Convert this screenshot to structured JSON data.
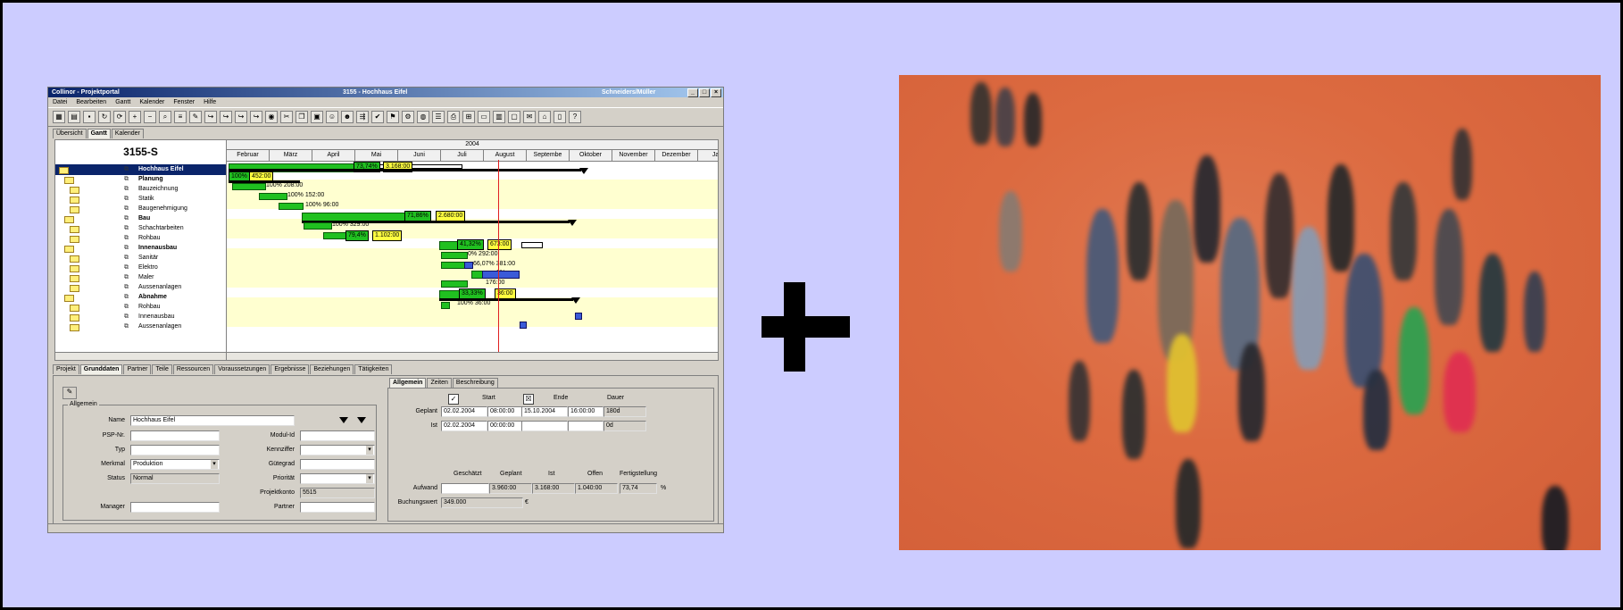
{
  "window": {
    "app_title": "Collinor - Projektportal",
    "doc_title": "3155 - Hochhaus Eifel",
    "user": "Schneiders/Müller"
  },
  "menu": [
    "Datei",
    "Bearbeiten",
    "Gantt",
    "Kalender",
    "Fenster",
    "Hilfe"
  ],
  "view_tabs": [
    "Übersicht",
    "Gantt",
    "Kalender"
  ],
  "project_code": "3155-S",
  "gantt": {
    "year": "2004",
    "months": [
      "Februar",
      "März",
      "April",
      "Mai",
      "Juni",
      "Juli",
      "August",
      "Septembe",
      "Oktober",
      "November",
      "Dezember",
      "Janu"
    ],
    "rows": [
      {
        "name": "Hochhaus Eifel",
        "selected": true,
        "bold": true
      },
      {
        "name": "Planung",
        "bold": true
      },
      {
        "name": "Bauzeichnung"
      },
      {
        "name": "Statik"
      },
      {
        "name": "Baugenehmigung"
      },
      {
        "name": "Bau",
        "bold": true
      },
      {
        "name": "Schachtarbeiten"
      },
      {
        "name": "Rohbau"
      },
      {
        "name": "Innenausbau",
        "bold": true
      },
      {
        "name": "Sanitär"
      },
      {
        "name": "Elektro"
      },
      {
        "name": "Maler"
      },
      {
        "name": "Aussenanlagen"
      },
      {
        "name": "Abnahme",
        "bold": true
      },
      {
        "name": "Rohbau"
      },
      {
        "name": "Innenausbau"
      },
      {
        "name": "Aussenanlagen"
      }
    ],
    "labels": {
      "r0_pct": "73,74%",
      "r0_val": "3.168:00",
      "r1_pct": "100%",
      "r1_val": "452:00",
      "r2": "100%  208:00",
      "r3": "100%  152:00",
      "r4": "100%  96:00",
      "r5_pct": "71,86%",
      "r5_val": "2.680:00",
      "r6": "100%  329:00",
      "r7_pct": "79,4%",
      "r7_val": "1.102:00",
      "r8_pct": "41,32%",
      "r8_val": "673:00",
      "r9": "0%  292:00",
      "r10": "66,07%  381:00",
      "r11": "0%",
      "r12": "176:00",
      "r13_pct": "33,33%",
      "r13_val": "36:00",
      "r14": "100%  36:00"
    }
  },
  "detail_tabs": [
    "Projekt",
    "Grunddaten",
    "Partner",
    "Teile",
    "Ressourcen",
    "Voraussetzungen",
    "Ergebnisse",
    "Beziehungen",
    "Tätigkeiten"
  ],
  "left_form": {
    "group": "Allgemein",
    "name_label": "Name",
    "name_value": "Hochhaus Eifel",
    "psp_label": "PSP-Nr.",
    "typ_label": "Typ",
    "merkmal_label": "Merkmal",
    "merkmal_value": "Produktion",
    "status_label": "Status",
    "status_value": "Normal",
    "manager_label": "Manager",
    "modul_label": "Modul-Id",
    "kennziffer_label": "Kennziffer",
    "guetegrad_label": "Gütegrad",
    "prioritaet_label": "Priorität",
    "konto_label": "Projektkonto",
    "konto_value": "5515",
    "partner_label": "Partner"
  },
  "right_tabs": [
    "Allgemein",
    "Zeiten",
    "Beschreibung"
  ],
  "right_form": {
    "col_start": "Start",
    "col_end": "Ende",
    "col_dauer": "Dauer",
    "geplant_label": "Geplant",
    "geplant_start_date": "02.02.2004",
    "geplant_start_time": "08:00:00",
    "geplant_end_date": "15.10.2004",
    "geplant_end_time": "16:00:00",
    "geplant_dauer": "180d",
    "ist_label": "Ist",
    "ist_start_date": "02.02.2004",
    "ist_start_time": "00:00:00",
    "ist_dauer": "0d",
    "col_geschaetzt": "Geschätzt",
    "col_geplant": "Geplant",
    "col_ist": "Ist",
    "col_offen": "Offen",
    "col_fertig": "Fertigstellung",
    "aufwand_label": "Aufwand",
    "aufwand_geplant": "3.960:00",
    "aufwand_ist": "3.168:00",
    "aufwand_offen": "1.040:00",
    "aufwand_fertig": "73,74",
    "percent_sign": "%",
    "buchungswert_label": "Buchungswert",
    "buchungswert_value": "349.000",
    "euro_sign": "€"
  },
  "colors": {
    "background": "#ccccff",
    "gantt_green": "#20c020",
    "gantt_yellow": "#ffff40",
    "gantt_blue": "#3a5ad8",
    "today_line": "#e02020"
  },
  "icons": [
    "plus-icon",
    "folder-icon",
    "task-icon",
    "dropdown-arrow-icon"
  ]
}
